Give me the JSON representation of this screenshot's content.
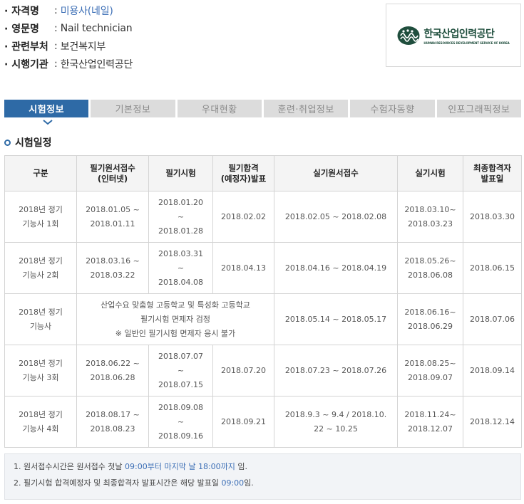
{
  "info": {
    "rows": [
      {
        "key": "· 자격명",
        "sep": ":",
        "value": "미용사(네일)",
        "link": true
      },
      {
        "key": "· 영문명",
        "sep": ":",
        "value": "Nail technician",
        "link": false
      },
      {
        "key": "· 관련부처",
        "sep": ":",
        "value": "보건복지부",
        "link": false
      },
      {
        "key": "· 시행기관",
        "sep": ":",
        "value": "한국산업인력공단",
        "link": false
      }
    ]
  },
  "logo": {
    "name_ko": "한국산업인력공단",
    "name_en": "HUMAN RESOURCES DEVELOPMENT SERVICE OF KOREA",
    "color": "#1f4e3d"
  },
  "tabs": [
    "시험정보",
    "기본정보",
    "우대현황",
    "훈련·취업정보",
    "수험자동향",
    "인포그래픽정보"
  ],
  "active_tab": 0,
  "section_title": "시험일정",
  "table": {
    "headers": [
      "구분",
      "필기원서접수\n(인터넷)",
      "필기시험",
      "필기합격\n(예정자)발표",
      "실기원서접수",
      "실기시험",
      "최종합격자\n발표일"
    ],
    "rows": [
      {
        "type": "normal",
        "cells": [
          "2018년 정기\n기능사 1회",
          "2018.01.05 ~\n2018.01.11",
          "2018.01.20\n~\n2018.01.28",
          "2018.02.02",
          "2018.02.05 ~ 2018.02.08",
          "2018.03.10~\n2018.03.23",
          "2018.03.30"
        ]
      },
      {
        "type": "normal",
        "cells": [
          "2018년 정기\n기능사 2회",
          "2018.03.16 ~\n2018.03.22",
          "2018.03.31\n~\n2018.04.08",
          "2018.04.13",
          "2018.04.16 ~ 2018.04.19",
          "2018.05.26~\n2018.06.08",
          "2018.06.15"
        ]
      },
      {
        "type": "merged",
        "cells": [
          "2018년 정기\n기능사",
          "산업수요 맞춤형 고등학교 및 특성화 고등학교\n필기시험 면제자 검정\n※ 일반인 필기시험 면제자 응시 불가",
          "2018.05.14 ~ 2018.05.17",
          "2018.06.16~\n2018.06.29",
          "2018.07.06"
        ]
      },
      {
        "type": "normal",
        "cells": [
          "2018년 정기\n기능사 3회",
          "2018.06.22 ~\n2018.06.28",
          "2018.07.07\n~\n2018.07.15",
          "2018.07.20",
          "2018.07.23 ~ 2018.07.26",
          "2018.08.25~\n2018.09.07",
          "2018.09.14"
        ]
      },
      {
        "type": "normal",
        "cells": [
          "2018년 정기\n기능사 4회",
          "2018.08.17 ~\n2018.08.23",
          "2018.09.08\n~\n2018.09.16",
          "2018.09.21",
          "2018.9.3 ~ 9.4 / 2018.10.\n22 ~ 10.25",
          "2018.11.24~\n2018.12.07",
          "2018.12.14"
        ]
      }
    ]
  },
  "notes": [
    {
      "parts": [
        {
          "t": "1. 원서접수시간은 원서접수 첫날 ",
          "hl": false
        },
        {
          "t": "09:00부터 마지막 날 18:00까지",
          "hl": true
        },
        {
          "t": " 임.",
          "hl": false
        }
      ]
    },
    {
      "parts": [
        {
          "t": "2. 필기시험 합격예정자 및 최종합격자 발표시간은 해당 발표일 ",
          "hl": false
        },
        {
          "t": "09:00",
          "hl": true
        },
        {
          "t": "임.",
          "hl": false
        }
      ]
    }
  ],
  "colors": {
    "accent": "#2e6aa6",
    "link": "#3d6fb6",
    "tab_inactive": "#dcdcdc"
  },
  "icons": {
    "tab_indicator": "chevron-down-icon",
    "section_bullet": "ring-bullet-icon"
  }
}
